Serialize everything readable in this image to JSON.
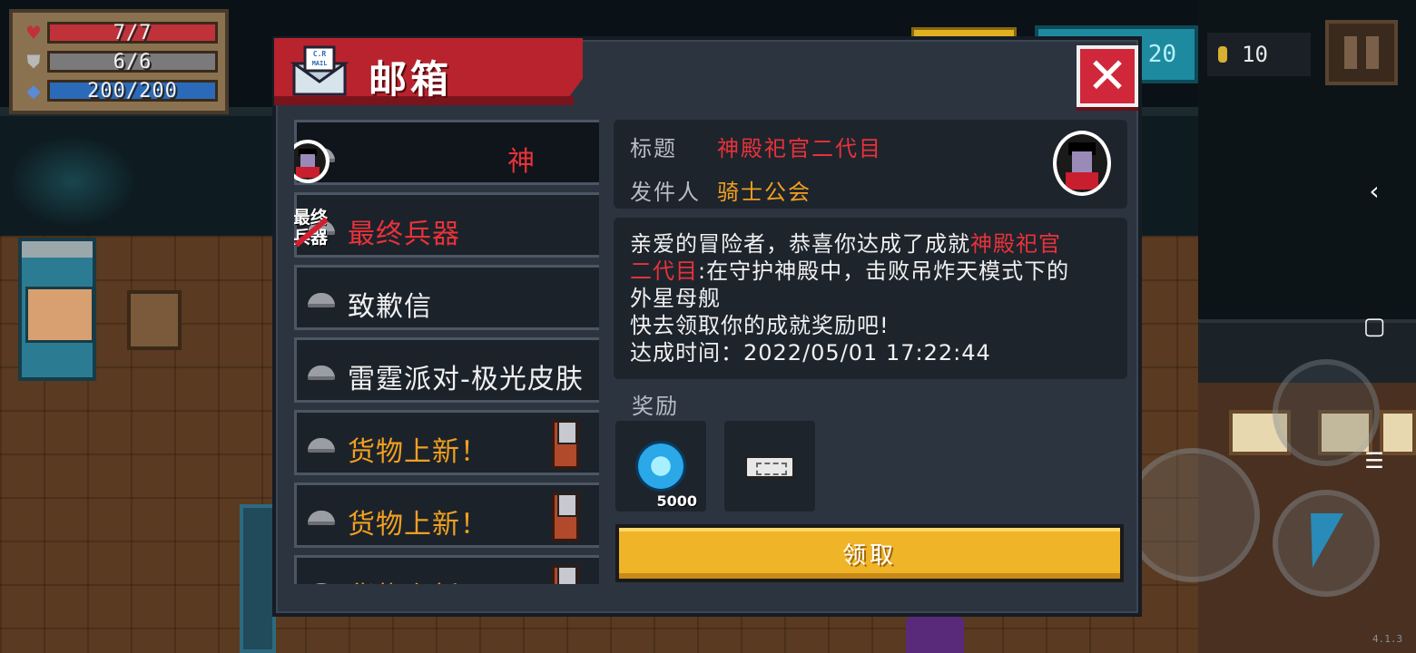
{
  "hud": {
    "hp": "7/7",
    "armor": "6/6",
    "energy": "200/200",
    "gems": "20",
    "coins": "10"
  },
  "mailbox": {
    "title": "邮箱",
    "mail_icon_text": "C.R MAIL",
    "close_symbol": "✕",
    "items": [
      {
        "label": "神",
        "color": "red",
        "thumb": "knight-avatar"
      },
      {
        "label": "最终兵器",
        "color": "red",
        "thumb": "final-weapon",
        "thumb_text": "最终兵器"
      },
      {
        "label": "致歉信",
        "color": "white",
        "thumb": ""
      },
      {
        "label": "雷霆派对-极光皮肤",
        "color": "white",
        "thumb": ""
      },
      {
        "label": "货物上新！",
        "color": "orange",
        "thumb": "merchant"
      },
      {
        "label": "货物上新！",
        "color": "orange",
        "thumb": "merchant"
      },
      {
        "label": "货物上新！",
        "color": "orange",
        "thumb": "merchant"
      }
    ],
    "detail": {
      "subject_label": "标题",
      "subject": "神殿祀官二代目",
      "sender_label": "发件人",
      "sender": "骑士公会",
      "body_line1_prefix": "亲爱的冒险者，恭喜你达成了成就",
      "body_line1_highlight": "神殿祀官",
      "body_line2_highlight": "二代目",
      "body_line2_rest": ":在守护神殿中，击败吊炸天模式下的",
      "body_line3": "外星母舰",
      "body_line4": "快去领取你的成就奖励吧!",
      "body_line5": "达成时间：2022/05/01 17:22:44",
      "rewards_label": "奖励",
      "rewards": [
        {
          "icon": "gem-icon",
          "amount": "5000"
        },
        {
          "icon": "ticket-icon",
          "amount": ""
        }
      ],
      "claim_label": "领取"
    }
  },
  "system_nav": {
    "back": "‹",
    "home": "▢",
    "menu": "☰"
  },
  "version": "4.1.3"
}
